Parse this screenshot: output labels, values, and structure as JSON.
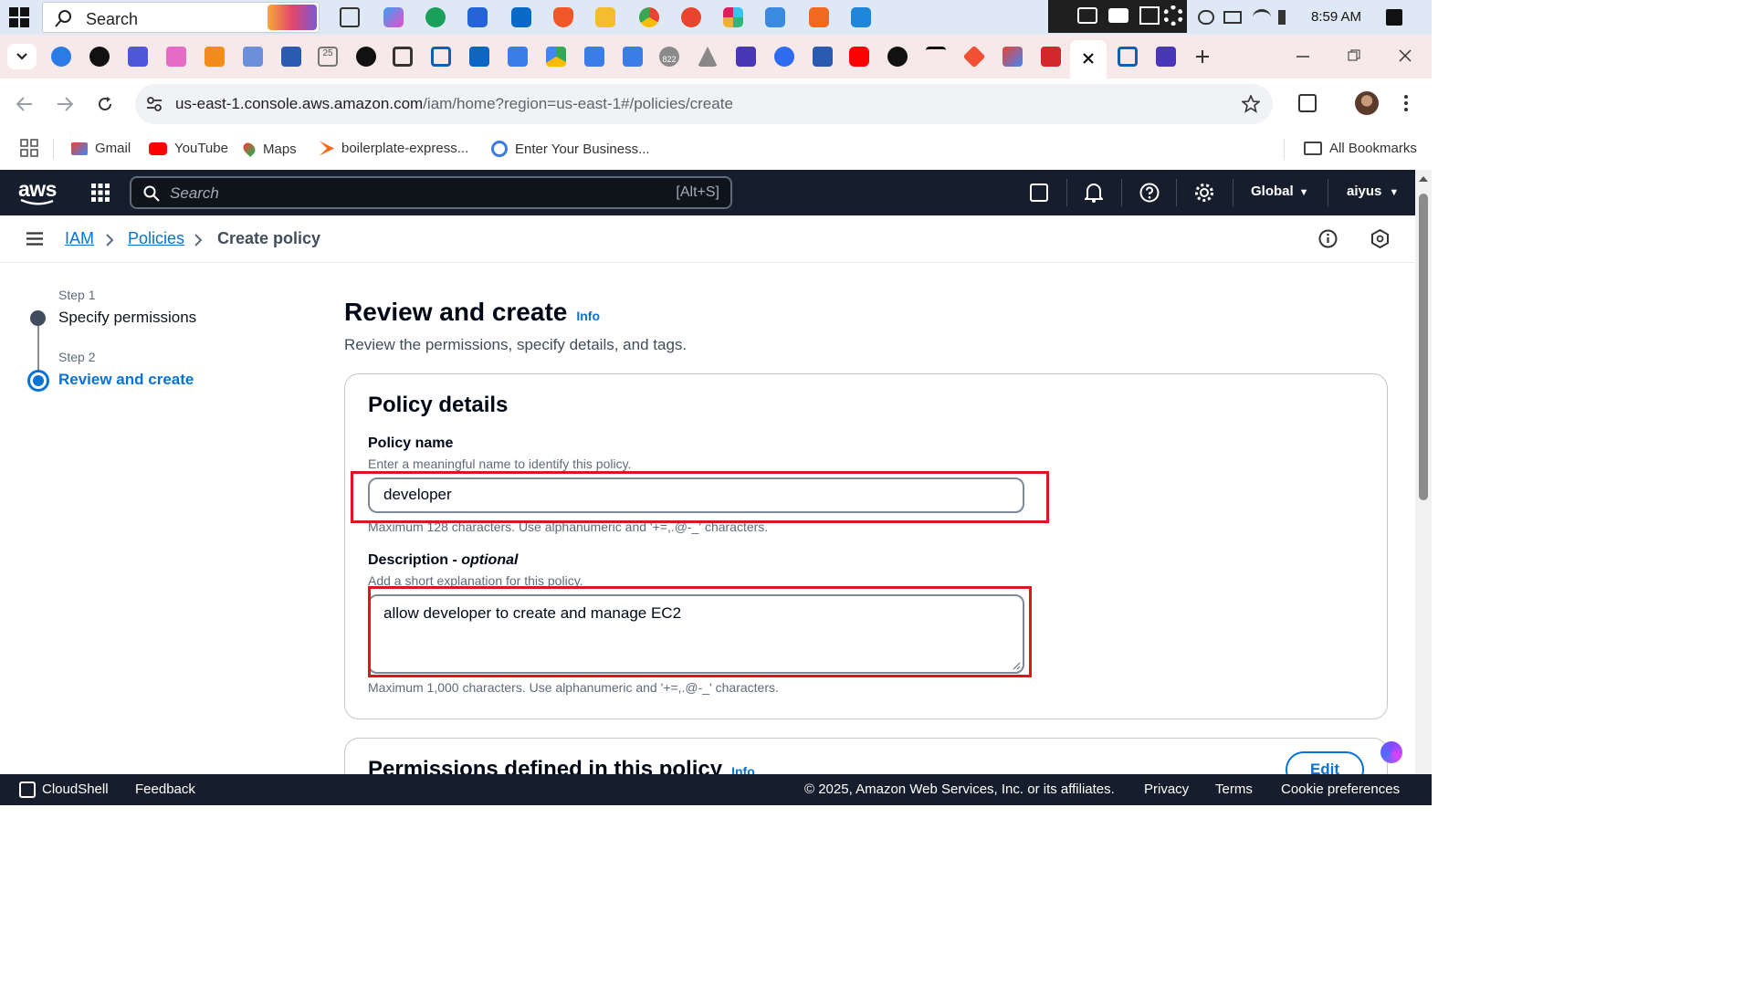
{
  "taskbar": {
    "search_placeholder": "Search",
    "time": "8:59 AM"
  },
  "browser": {
    "url_host": "us-east-1.console.aws.amazon.com",
    "url_path": "/iam/home?region=us-east-1#/policies/create",
    "bookmarks": [
      "Gmail",
      "YouTube",
      "Maps",
      "boilerplate-express...",
      "Enter Your Business..."
    ],
    "all_bookmarks": "All Bookmarks",
    "tab_badge": "822",
    "tab_badge2": "25"
  },
  "aws": {
    "logo": "aws",
    "search_placeholder": "Search",
    "search_shortcut": "[Alt+S]",
    "region": "Global",
    "user": "aiyus"
  },
  "breadcrumb": {
    "iam": "IAM",
    "policies": "Policies",
    "current": "Create policy"
  },
  "steps": [
    {
      "label": "Step 1",
      "name": "Specify permissions"
    },
    {
      "label": "Step 2",
      "name": "Review and create"
    }
  ],
  "page": {
    "title": "Review and create",
    "info": "Info",
    "description": "Review the permissions, specify details, and tags."
  },
  "policy_details": {
    "heading": "Policy details",
    "name_label": "Policy name",
    "name_hint": "Enter a meaningful name to identify this policy.",
    "name_value": "developer",
    "name_constraint": "Maximum 128 characters. Use alphanumeric and '+=,.@-_' characters.",
    "desc_label": "Description - ",
    "desc_optional": "optional",
    "desc_hint": "Add a short explanation for this policy.",
    "desc_value": "allow developer to create and manage EC2",
    "desc_constraint": "Maximum 1,000 characters. Use alphanumeric and '+=,.@-_' characters."
  },
  "permissions": {
    "heading": "Permissions defined in this policy",
    "info": "Info",
    "edit": "Edit"
  },
  "footer": {
    "cloudshell": "CloudShell",
    "feedback": "Feedback",
    "copyright": "© 2025, Amazon Web Services, Inc. or its affiliates.",
    "privacy": "Privacy",
    "terms": "Terms",
    "cookies": "Cookie preferences"
  },
  "colors": {
    "accent": "#0972d3",
    "aws_header": "#161e2d",
    "highlight": "#e0141e"
  }
}
